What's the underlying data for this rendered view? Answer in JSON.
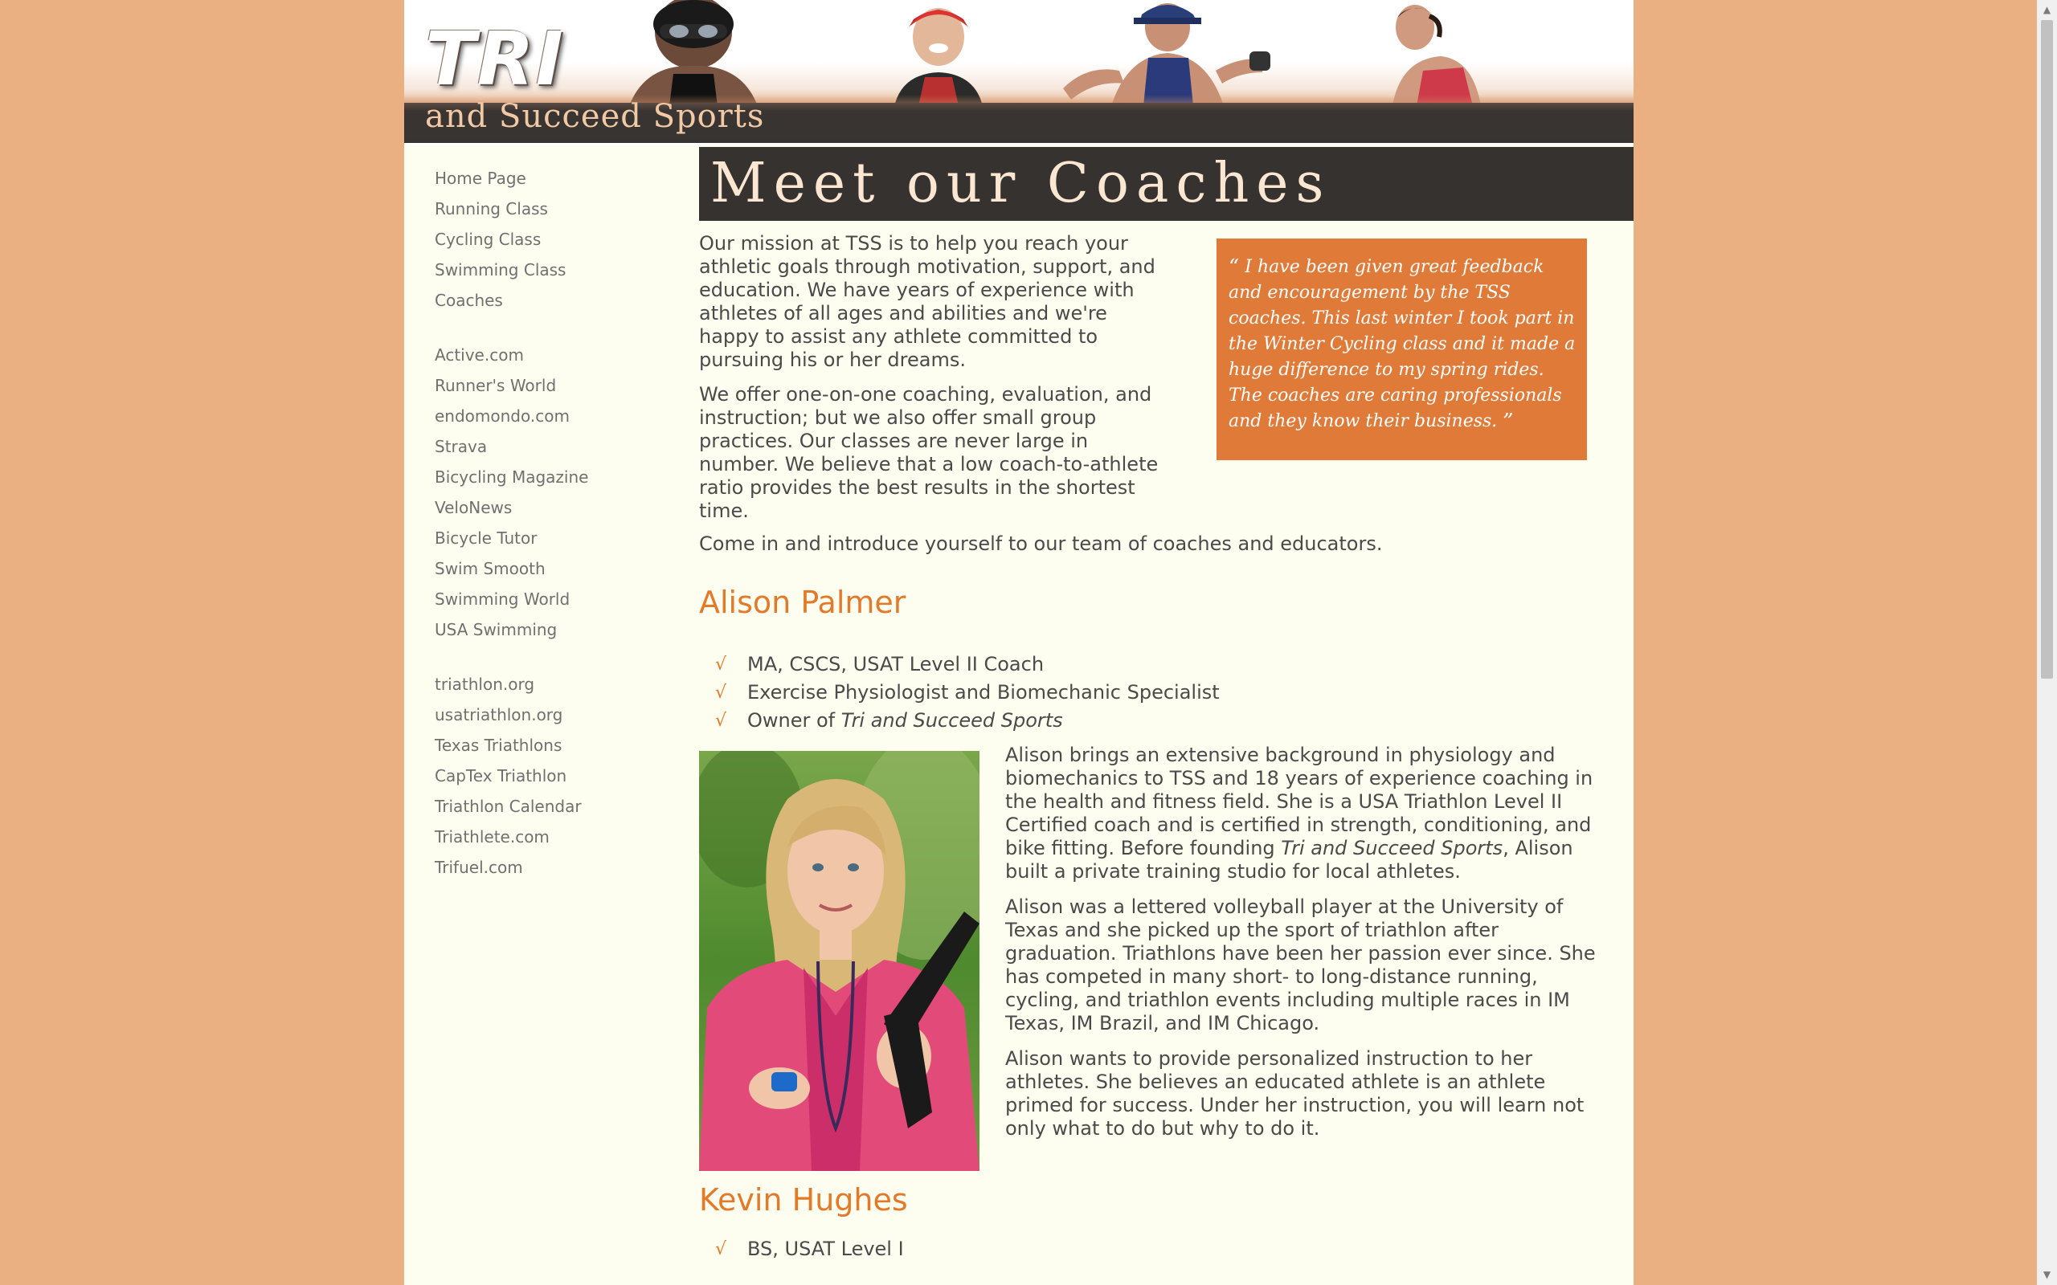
{
  "banner": {
    "logo": "TRI",
    "tagline": "and Succeed Sports"
  },
  "nav": {
    "site_links": [
      "Home Page",
      "Running Class",
      "Cycling Class",
      "Swimming Class",
      "Coaches"
    ],
    "running_links": [
      "Active.com",
      "Runner's World",
      "endomondo.com",
      "Strava",
      "Bicycling Magazine",
      "VeloNews",
      "Bicycle Tutor",
      "Swim Smooth",
      "Swimming World",
      "USA Swimming"
    ],
    "tri_links": [
      "triathlon.org",
      "usatriathlon.org",
      "Texas Triathlons",
      "CapTex Triathlon",
      "Triathlon Calendar",
      "Triathlete.com",
      "Trifuel.com"
    ]
  },
  "main": {
    "title": "Meet our Coaches",
    "intro_p1": "Our mission at TSS is to help you reach your athletic goals through motivation, support, and education. We have years of experience with athletes of all ages and abilities and we're happy to assist any athlete committed to pursuing his or her dreams.",
    "intro_p2": "We offer one-on-one coaching, evaluation, and instruction; but we also offer small group practices. Our classes are never large in number. We believe that a low coach-to-athlete ratio provides the best results in the shortest time.",
    "quote_open": "“",
    "quote": "I have been given great feedback and encouragement by the TSS coaches. This last winter I took part in the Winter Cycling class and it made a huge difference to my spring rides. The coaches are caring professionals and they know their business.",
    "quote_close": "”",
    "come_in": "Come in and introduce yourself to our team of coaches and educators.",
    "check_glyph": "√"
  },
  "coaches": [
    {
      "name": "Alison Palmer",
      "credentials": [
        "MA, CSCS, USAT Level II Coach",
        "Exercise Physiologist and Biomechanic Specialist"
      ],
      "owner_prefix": "Owner of ",
      "owner_company": "Tri and Succeed Sports",
      "bio_p1_a": "Alison brings an extensive background in physiology and biomechanics to TSS and 18 years of experience coaching in the health and fitness field. She is a USA Triathlon Level II Certified coach and is certified in strength, conditioning, and bike fitting. Before founding ",
      "bio_p1_em": "Tri and Succeed Sports",
      "bio_p1_b": ", Alison built a private training studio for local athletes.",
      "bio_p2": "Alison was a lettered volleyball player at the University of Texas and she picked up the sport of triathlon after graduation. Triathlons have been her passion ever since. She has competed in many short- to long-distance running, cycling, and triathlon events including multiple races in IM Texas, IM Brazil, and IM Chicago.",
      "bio_p3": "Alison wants to provide personalized instruction to her athletes. She believes an educated athlete is an athlete primed for success. Under her instruction, you will learn not only what to do but why to do it."
    },
    {
      "name": "Kevin Hughes",
      "credentials": [
        "BS, USAT Level I"
      ]
    }
  ],
  "colors": {
    "page_bg": "#EBB082",
    "content_bg": "#FEFEF0",
    "accent": "#E27A2A",
    "quote_bg": "#E07A38",
    "title_bar": "#353230"
  }
}
